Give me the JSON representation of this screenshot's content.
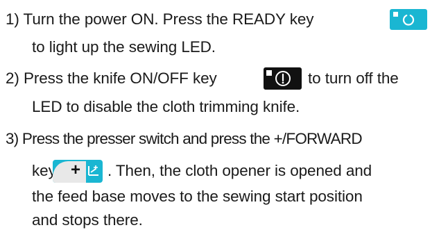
{
  "steps": [
    {
      "line1": "1) Turn the power ON. Press the READY key",
      "line2": "to light up the sewing LED."
    },
    {
      "line1a": "2) Press the knife ON/OFF key",
      "line1b": "to turn off the",
      "line2": "LED to disable the cloth trimming knife."
    },
    {
      "line1": "3) Press the presser switch and press the +/FORWARD",
      "line2a": "key",
      "line2b": ". Then, the cloth opener is opened and",
      "line3": "the feed base moves to the sewing start position",
      "line4": "and stops there."
    }
  ],
  "keys": {
    "ready": {
      "icon": "power-cycle-icon",
      "color": "#1ab6d2"
    },
    "knife": {
      "icon": "knife-toggle-icon",
      "color": "#111111"
    },
    "forward": {
      "icon": "plus-forward-icon",
      "color": "#1ab6d2",
      "glyph": "+"
    }
  }
}
